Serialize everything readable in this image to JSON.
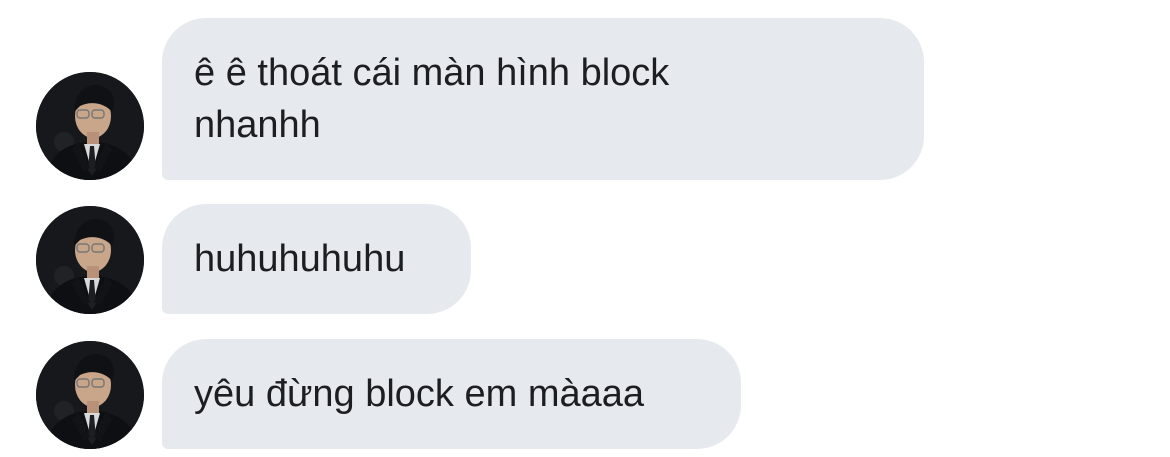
{
  "conversation": {
    "messages": [
      {
        "text": "ê ê thoát cái màn hình block nhanhh",
        "avatar": "avatar-photo"
      },
      {
        "text": "huhuhuhuhu",
        "avatar": "avatar-photo"
      },
      {
        "text": "yêu đừng block em màaaa",
        "avatar": "avatar-photo"
      }
    ]
  },
  "colors": {
    "bubble_background": "#e6eaee",
    "bubble_text": "#1c1e21",
    "page_background": "#ffffff"
  }
}
